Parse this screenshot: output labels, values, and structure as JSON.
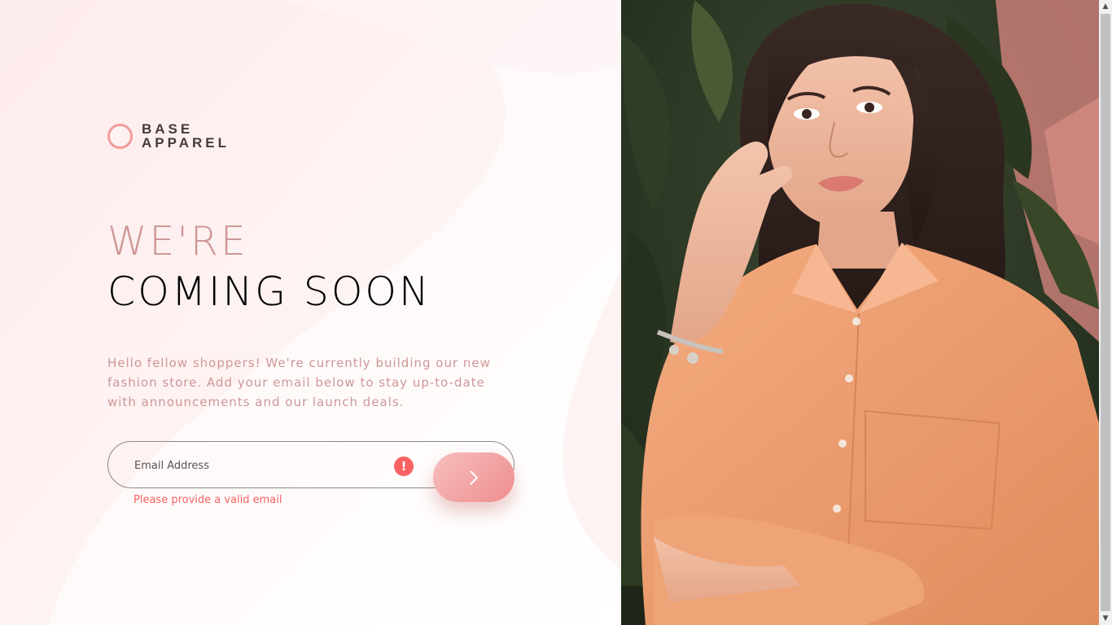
{
  "brand": {
    "line1": "BASE",
    "line2": "APPAREL"
  },
  "headline": {
    "light": "WE'RE",
    "dark": "COMING SOON"
  },
  "intro": "Hello fellow shoppers! We're currently building our new fashion store. Add your email below to stay up-to-date with announcements and our launch deals.",
  "form": {
    "email_placeholder": "Email Address",
    "email_value": "",
    "error_icon": "exclamation-icon",
    "error_message": "Please provide a valid email",
    "submit_icon": "chevron-right-icon"
  },
  "colors": {
    "accent": "#ce9797",
    "dark_text": "#423a3a",
    "error": "#f96262",
    "button_gradient_start": "#f8bfbf",
    "button_gradient_end": "#ee8c8c"
  },
  "scrollbar": {
    "up_icon": "arrow-up-icon",
    "down_icon": "arrow-down-icon"
  }
}
